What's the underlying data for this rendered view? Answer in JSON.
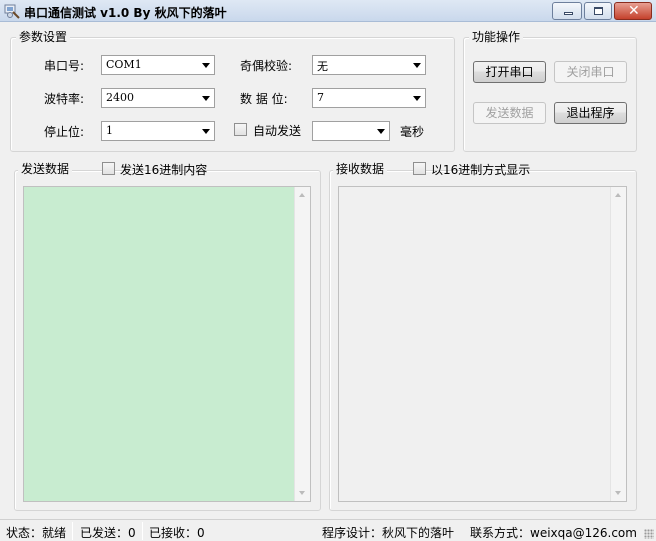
{
  "window": {
    "title": "串口通信测试 v1.0 By 秋风下的落叶",
    "controls": [
      "minimize-icon",
      "maximize-icon",
      "close-icon"
    ],
    "close_glyph": "✕"
  },
  "params": {
    "legend": "参数设置",
    "port_label": "串口号:",
    "port_value": "COM1",
    "parity_label": "奇偶校验:",
    "parity_value": "无",
    "baud_label": "波特率:",
    "baud_value": "2400",
    "databits_label": "数 据 位:",
    "databits_value": "7",
    "stopbits_label": "停止位:",
    "stopbits_value": "1",
    "autosend_label": "自动发送",
    "autosend_checked": false,
    "interval_value": "",
    "interval_unit": "毫秒"
  },
  "ops": {
    "legend": "功能操作",
    "open_port": "打开串口",
    "close_port": "关闭串口",
    "send_data": "发送数据",
    "exit": "退出程序"
  },
  "send": {
    "legend": "发送数据",
    "hex_label": "发送16进制内容",
    "hex_checked": false,
    "content": "",
    "bg_color": "#c8ecd0"
  },
  "receive": {
    "legend": "接收数据",
    "hex_label": "以16进制方式显示",
    "hex_checked": false,
    "content": ""
  },
  "status": {
    "state": "状态：就绪",
    "sent": "已发送：0",
    "received": "已接收：0",
    "designer": "程序设计：秋风下的落叶",
    "contact": "联系方式：weixqa@126.com"
  }
}
